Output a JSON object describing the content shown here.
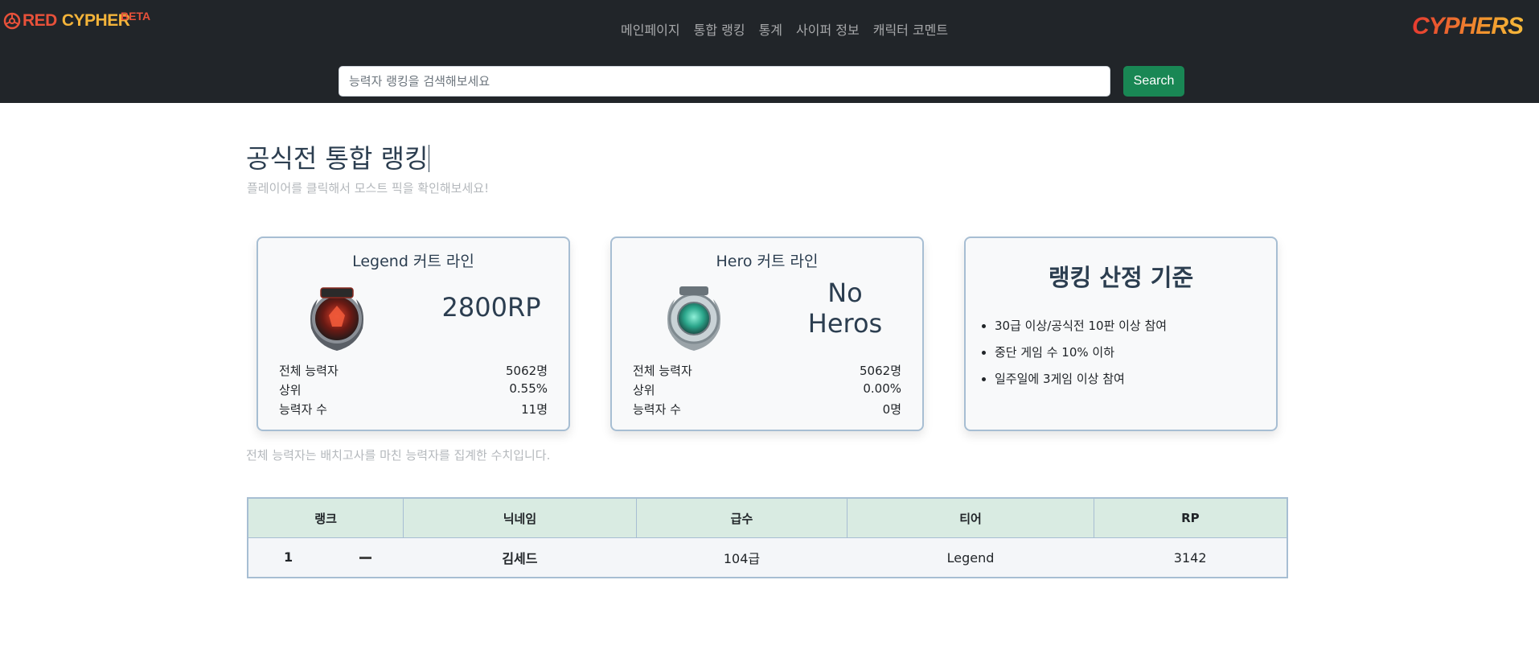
{
  "header": {
    "logo_red": "RED",
    "logo_cypher": "CYPHER",
    "logo_beta": "BETA",
    "nav": [
      "메인페이지",
      "통합 랭킹",
      "통계",
      "사이퍼 정보",
      "캐릭터 코멘트"
    ],
    "brand_right": "CYPHERS",
    "search": {
      "placeholder": "능력자 랭킹을 검색해보세요",
      "button": "Search"
    }
  },
  "page": {
    "title": "공식전 통합 랭킹",
    "subtitle": "플레이어를 클릭해서 모스트 픽을 확인해보세요!",
    "note": "전체 능력자는 배치고사를 마친 능력자를 집계한 수치입니다."
  },
  "cards": [
    {
      "title": "Legend 커트 라인",
      "emblem": "legend-emblem-icon",
      "value": "2800RP",
      "stats": [
        {
          "label": "전체 능력자",
          "value": "5062명"
        },
        {
          "label": "상위",
          "value": "0.55%"
        },
        {
          "label": "능력자 수",
          "value": "11명"
        }
      ]
    },
    {
      "title": "Hero 커트 라인",
      "emblem": "hero-emblem-icon",
      "value_line1": "No",
      "value_line2": "Heros",
      "stats": [
        {
          "label": "전체 능력자",
          "value": "5062명"
        },
        {
          "label": "상위",
          "value": "0.00%"
        },
        {
          "label": "능력자 수",
          "value": "0명"
        }
      ]
    }
  ],
  "criteria": {
    "title": "랭킹 산정 기준",
    "items": [
      "30급 이상/공식전 10판 이상 참여",
      "중단 게임 수 10% 이하",
      "일주일에 3게임 이상 참여"
    ]
  },
  "table": {
    "headers": [
      "랭크",
      "닉네임",
      "급수",
      "티어",
      "RP"
    ],
    "rows": [
      {
        "rank": "1",
        "nickname": "김세드",
        "level": "104급",
        "tier": "Legend",
        "rp": "3142"
      }
    ]
  },
  "colors": {
    "header_bg": "#212529",
    "search_button": "#198754",
    "card_border": "#a7bed3",
    "table_header_bg": "#d9ebe2"
  }
}
